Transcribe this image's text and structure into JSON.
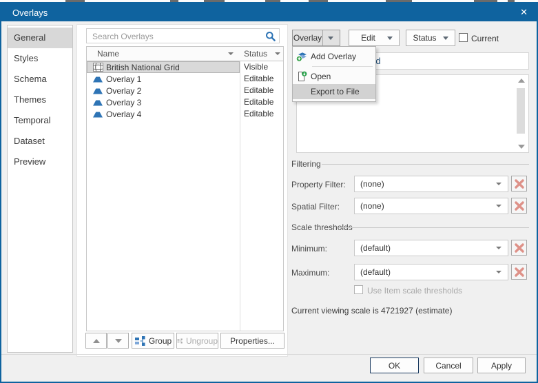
{
  "window": {
    "title": "Overlays",
    "close_glyph": "✕"
  },
  "colors": {
    "title_bar": "#0f639f",
    "accent_blue": "#2e74b5",
    "selection_gray": "#d9d9d9",
    "delete_x": "#de9188",
    "menu_highlight": "#d2d2d2"
  },
  "sidebar": {
    "items": [
      {
        "label": "General",
        "selected": true
      },
      {
        "label": "Styles",
        "selected": false
      },
      {
        "label": "Schema",
        "selected": false
      },
      {
        "label": "Themes",
        "selected": false
      },
      {
        "label": "Temporal",
        "selected": false
      },
      {
        "label": "Dataset",
        "selected": false
      },
      {
        "label": "Preview",
        "selected": false
      }
    ]
  },
  "search": {
    "placeholder": "Search Overlays"
  },
  "list": {
    "columns": [
      {
        "label": "Name"
      },
      {
        "label": "Status"
      }
    ],
    "rows": [
      {
        "name": "British National Grid",
        "status": "Visible",
        "icon": "british-national-grid-icon",
        "selected": true
      },
      {
        "name": "Overlay 1",
        "status": "Editable",
        "icon": "overlay-icon",
        "selected": false
      },
      {
        "name": "Overlay 2",
        "status": "Editable",
        "icon": "overlay-icon",
        "selected": false
      },
      {
        "name": "Overlay 3",
        "status": "Editable",
        "icon": "overlay-icon",
        "selected": false
      },
      {
        "name": "Overlay 4",
        "status": "Editable",
        "icon": "overlay-icon",
        "selected": false
      }
    ],
    "toolbar": {
      "group": "Group",
      "ungroup": "Ungroup",
      "properties": "Properties..."
    }
  },
  "actions": {
    "overlay": "Overlay",
    "edit": "Edit",
    "status": "Status",
    "current": "Current",
    "current_checked": false
  },
  "overlay_menu": {
    "items": [
      {
        "label": "Add Overlay",
        "icon": "add-overlay-icon",
        "highlighted": false
      },
      {
        "label": "Open",
        "icon": "open-icon",
        "highlighted": false
      },
      {
        "label": "Export to File",
        "icon": "",
        "highlighted": true
      }
    ]
  },
  "details": {
    "name_value": "British National Grid",
    "description_value": "",
    "filtering": {
      "section": "Filtering",
      "property_label": "Property Filter:",
      "property_value": "(none)",
      "spatial_label": "Spatial Filter:",
      "spatial_value": "(none)"
    },
    "scale": {
      "section": "Scale thresholds",
      "minimum_label": "Minimum:",
      "minimum_value": "(default)",
      "maximum_label": "Maximum:",
      "maximum_value": "(default)",
      "use_item_label": "Use Item scale thresholds",
      "use_item_checked": false,
      "viewing_scale_text": "Current viewing scale is 4721927 (estimate)"
    }
  },
  "footer": {
    "ok": "OK",
    "cancel": "Cancel",
    "apply": "Apply"
  }
}
